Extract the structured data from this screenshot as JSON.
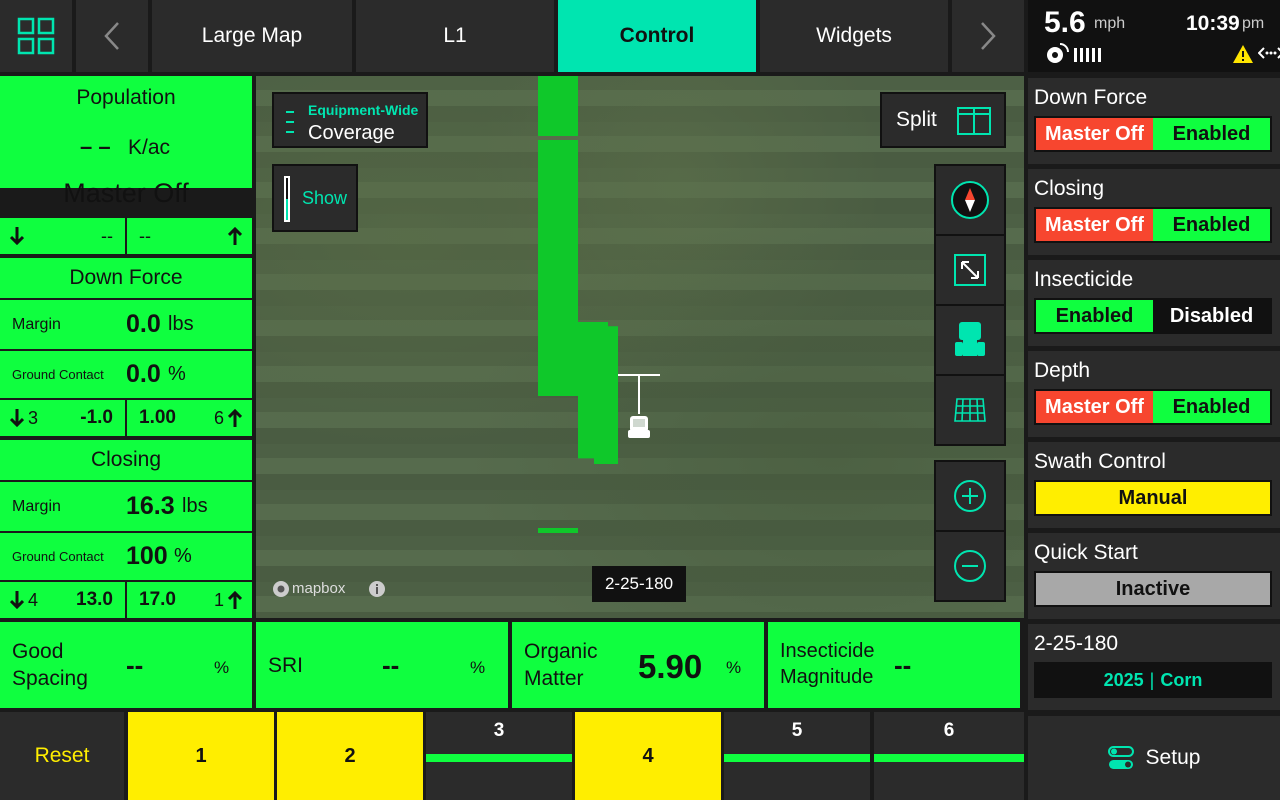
{
  "nav": {
    "tabs": [
      "Large Map",
      "L1",
      "Control",
      "Widgets"
    ],
    "active": "Control"
  },
  "status": {
    "speed": "5.6",
    "speed_unit": "mph",
    "time": "10:39",
    "ampm": "pm"
  },
  "population": {
    "title": "Population",
    "value": "– –",
    "unit": "K/ac",
    "state": "Master Off",
    "left": "--",
    "right": "--"
  },
  "downforce": {
    "title": "Down Force",
    "margin_label": "Margin",
    "margin": "0.0",
    "margin_unit": "lbs",
    "gc_label": "Ground Contact",
    "gc": "0.0",
    "gc_unit": "%",
    "row_l": "3",
    "val_l": "-1.0",
    "val_r": "1.00",
    "row_r": "6"
  },
  "closing": {
    "title": "Closing",
    "margin_label": "Margin",
    "margin": "16.3",
    "margin_unit": "lbs",
    "gc_label": "Ground Contact",
    "gc": "100",
    "gc_unit": "%",
    "row_l": "4",
    "val_l": "13.0",
    "val_r": "17.0",
    "row_r": "1"
  },
  "metrics": [
    {
      "label1": "Good",
      "label2": "Spacing",
      "value": "--",
      "unit": "%"
    },
    {
      "label1": "SRI",
      "label2": "",
      "value": "--",
      "unit": "%"
    },
    {
      "label1": "Organic",
      "label2": "Matter",
      "value": "5.90",
      "unit": "%"
    },
    {
      "label1": "Insecticide",
      "label2": "Magnitude",
      "value": "--",
      "unit": ""
    }
  ],
  "map": {
    "coverage_small": "Equipment-Wide",
    "coverage": "Coverage",
    "show": "Show",
    "split": "Split",
    "field_label": "2-25-180",
    "attribution": "mapbox"
  },
  "right": {
    "downforce": {
      "title": "Down Force",
      "a": "Master Off",
      "b": "Enabled"
    },
    "closing": {
      "title": "Closing",
      "a": "Master Off",
      "b": "Enabled"
    },
    "insecticide": {
      "title": "Insecticide",
      "a": "Enabled",
      "b": "Disabled"
    },
    "depth": {
      "title": "Depth",
      "a": "Master Off",
      "b": "Enabled"
    },
    "swath": {
      "title": "Swath Control",
      "value": "Manual"
    },
    "quickstart": {
      "title": "Quick Start",
      "value": "Inactive"
    },
    "field": {
      "title": "2-25-180",
      "year": "2025",
      "sep": "|",
      "crop": "Corn"
    },
    "setup": "Setup"
  },
  "rows": {
    "reset": "Reset",
    "items": [
      "1",
      "2",
      "3",
      "4",
      "5",
      "6"
    ]
  }
}
